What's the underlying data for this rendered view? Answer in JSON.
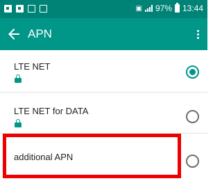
{
  "status_bar": {
    "battery": "97%",
    "time": "13:44",
    "left_icons": [
      "notification-icon",
      "gallery-icon",
      "image-icon",
      "download-icon"
    ],
    "right_icons": [
      "screen-cast-icon",
      "signal-icon",
      "battery-icon"
    ]
  },
  "app_bar": {
    "title": "APN",
    "back_icon": "arrow-left-icon",
    "menu_icon": "more-vert-icon"
  },
  "apn_list": [
    {
      "name": "LTE NET",
      "locked": true,
      "selected": true
    },
    {
      "name": "LTE NET for DATA",
      "locked": true,
      "selected": false
    },
    {
      "name": "additional APN",
      "locked": false,
      "selected": false
    }
  ],
  "colors": {
    "status_bar": "#008377",
    "app_bar": "#009688",
    "accent": "#009688",
    "highlight": "#ee0000"
  }
}
